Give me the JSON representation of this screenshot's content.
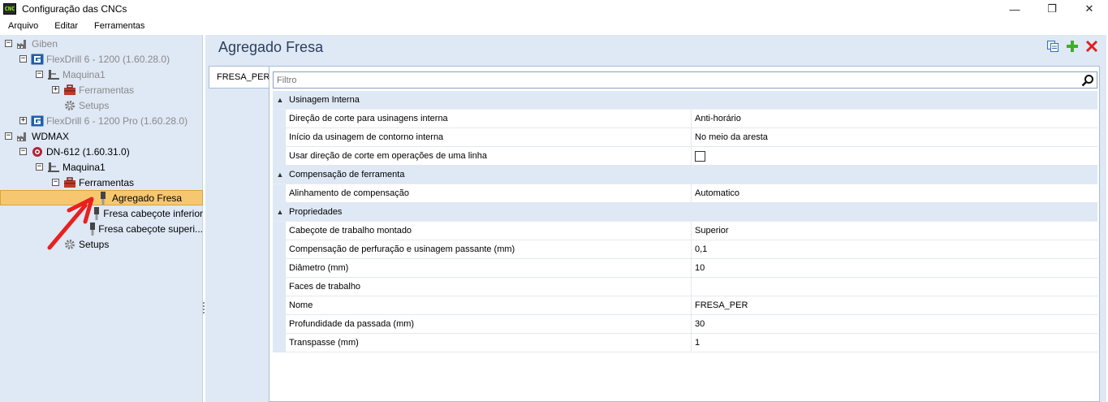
{
  "window": {
    "title": "Configuração das CNCs",
    "app_icon_text": "CNC",
    "minimize_glyph": "—",
    "maximize_glyph": "❐",
    "close_glyph": "✕"
  },
  "menu": [
    "Arquivo",
    "Editar",
    "Ferramentas"
  ],
  "tree": [
    {
      "label": "Giben",
      "expander": "⊟",
      "icon": "factory-icon",
      "disabled": true
    },
    {
      "label": "FlexDrill 6 - 1200 (1.60.28.0)",
      "expander": "⊟",
      "icon": "g-brand-icon",
      "disabled": true
    },
    {
      "label": "Maquina1",
      "expander": "⊟",
      "icon": "machine-icon",
      "disabled": true
    },
    {
      "label": "Ferramentas",
      "expander": "⊞",
      "icon": "toolbox-icon",
      "disabled": true
    },
    {
      "label": "Setups",
      "expander": "",
      "icon": "gear-icon",
      "disabled": true
    },
    {
      "label": "FlexDrill 6 - 1200 Pro (1.60.28.0)",
      "expander": "⊞",
      "icon": "g-brand-icon",
      "disabled": true
    },
    {
      "label": "WDMAX",
      "expander": "⊟",
      "icon": "factory-icon",
      "disabled": false
    },
    {
      "label": "DN-612 (1.60.31.0)",
      "expander": "⊟",
      "icon": "globe-icon",
      "disabled": false
    },
    {
      "label": "Maquina1",
      "expander": "⊟",
      "icon": "machine-icon",
      "disabled": false
    },
    {
      "label": "Ferramentas",
      "expander": "⊟",
      "icon": "toolbox-icon",
      "disabled": false
    },
    {
      "label": "Agregado Fresa",
      "expander": "",
      "icon": "mill-tool-icon",
      "disabled": false,
      "selected": true
    },
    {
      "label": "Fresa cabeçote inferior",
      "expander": "",
      "icon": "mill-tool-icon",
      "disabled": false
    },
    {
      "label": "Fresa cabeçote superi...",
      "expander": "",
      "icon": "mill-tool-icon",
      "disabled": false
    },
    {
      "label": "Setups",
      "expander": "",
      "icon": "gear-icon",
      "disabled": false
    }
  ],
  "panel": {
    "title": "Agregado Fresa",
    "tab": "FRESA_PER",
    "filter_placeholder": "Filtro",
    "toolbar_icons": [
      "copy-icon",
      "add-icon",
      "delete-icon"
    ]
  },
  "properties": [
    {
      "category": "Usinagem Interna",
      "rows": [
        {
          "name": "Direção de corte para usinagens interna",
          "value": "Anti-horário"
        },
        {
          "name": "Início da usinagem de contorno interna",
          "value": "No meio da aresta"
        },
        {
          "name": "Usar direção de corte em operações de uma linha",
          "value": "",
          "checkbox": true,
          "checked": false
        }
      ]
    },
    {
      "category": "Compensação de ferramenta",
      "rows": [
        {
          "name": "Alinhamento de compensação",
          "value": "Automatico"
        }
      ]
    },
    {
      "category": "Propriedades",
      "rows": [
        {
          "name": "Cabeçote de trabalho montado",
          "value": "Superior"
        },
        {
          "name": "Compensação de perfuração e usinagem passante (mm)",
          "value": "0,1"
        },
        {
          "name": "Diâmetro (mm)",
          "value": "10"
        },
        {
          "name": "Faces de trabalho",
          "value": ""
        },
        {
          "name": "Nome",
          "value": "FRESA_PER"
        },
        {
          "name": "Profundidade da passada (mm)",
          "value": "30"
        },
        {
          "name": "Transpasse (mm)",
          "value": "1"
        }
      ]
    }
  ],
  "colors": {
    "selection": "#f7c770",
    "panel_bg": "#dfe8f5",
    "annotation_arrow": "#e8201f"
  }
}
